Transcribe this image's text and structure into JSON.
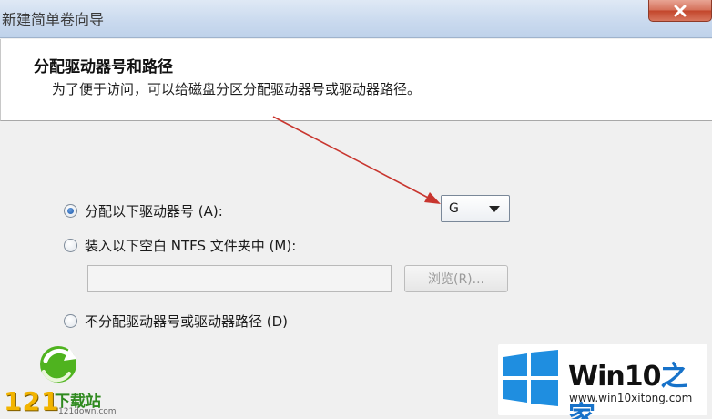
{
  "window": {
    "title": "新建简单卷向导",
    "close_icon": "close-icon"
  },
  "header": {
    "title": "分配驱动器号和路径",
    "subtitle": "为了便于访问，可以给磁盘分区分配驱动器号或驱动器路径。"
  },
  "options": {
    "assign_letter": {
      "label": "分配以下驱动器号 (A):",
      "checked": true
    },
    "mount_folder": {
      "label": "装入以下空白 NTFS 文件夹中 (M):",
      "checked": false
    },
    "no_assign": {
      "label": "不分配驱动器号或驱动器路径 (D)",
      "checked": false
    }
  },
  "drive_select": {
    "value": "G"
  },
  "folder_path": {
    "value": ""
  },
  "browse_button": {
    "label": "浏览(R)..."
  },
  "watermarks": {
    "left_number": "121",
    "left_text": "下载站",
    "left_url": "121down.com",
    "right_brand": "Win10",
    "right_brand_suffix": "之家",
    "right_url": "www.win10xitong.com"
  },
  "colors": {
    "annotation_arrow": "#c8352e",
    "win_logo": "#1f8ee0"
  }
}
